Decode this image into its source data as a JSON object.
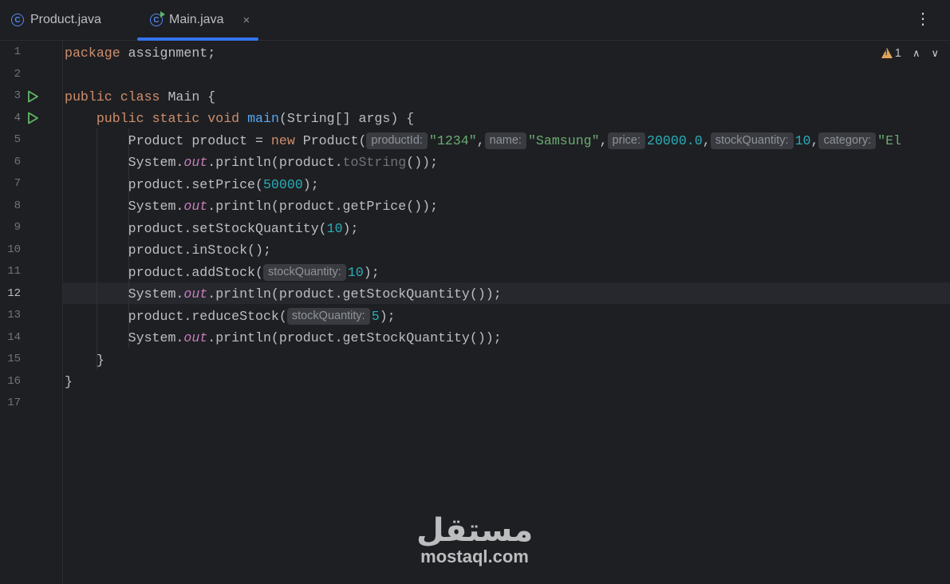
{
  "tabs": [
    {
      "label": "Product.java",
      "active": false,
      "icon": "class-icon"
    },
    {
      "label": "Main.java",
      "active": true,
      "icon": "runnable-class-icon",
      "close": "×"
    }
  ],
  "menu_glyph": "⋮",
  "inspection": {
    "warning_count": "1",
    "up": "∧",
    "down": "∨"
  },
  "line_numbers": [
    "1",
    "2",
    "3",
    "4",
    "5",
    "6",
    "7",
    "8",
    "9",
    "10",
    "11",
    "12",
    "13",
    "14",
    "15",
    "16",
    "17"
  ],
  "current_line": 12,
  "code": {
    "l1": {
      "kw": "package",
      "rest": " assignment;"
    },
    "l3": {
      "kw1": "public",
      "kw2": "class",
      "rest": " Main {"
    },
    "l4": {
      "kw1": "public",
      "kw2": "static",
      "kw3": "void",
      "fn": "main",
      "rest": "(String[] args) {"
    },
    "l5": {
      "a": "Product product = ",
      "kw": "new",
      "b": " Product(",
      "h1": "productId:",
      "s1": "\"1234\"",
      "c1": ",",
      "h2": "name:",
      "s2": "\"Samsung\"",
      "c2": ",",
      "h3": "price:",
      "n1": "20000.0",
      "c3": ",",
      "h4": "stockQuantity:",
      "n2": "10",
      "c4": ",",
      "h5": "category:",
      "s3": "\"El"
    },
    "l6": {
      "a": "System.",
      "stat": "out",
      "b": ".println(product.",
      "dim": "toString",
      "c": "());"
    },
    "l7": {
      "a": "product.setPrice(",
      "num": "50000",
      "b": ");"
    },
    "l8": {
      "a": "System.",
      "stat": "out",
      "b": ".println(product.getPrice());"
    },
    "l9": {
      "a": "product.setStockQuantity(",
      "num": "10",
      "b": ");"
    },
    "l10": {
      "a": "product.inStock();"
    },
    "l11": {
      "a": "product.addStock(",
      "hint": "stockQuantity:",
      "num": "10",
      "b": ");"
    },
    "l12": {
      "a": "System.",
      "stat": "out",
      "b": ".println(product.getStockQuantity());"
    },
    "l13": {
      "a": "product.reduceStock(",
      "hint": "stockQuantity:",
      "num": "5",
      "b": ");"
    },
    "l14": {
      "a": "System.",
      "stat": "out",
      "b": ".println(product.getStockQuantity());"
    },
    "l15": {
      "a": "}"
    },
    "l16": {
      "a": "}"
    }
  },
  "watermark": {
    "arabic": "مستقل",
    "latin": "mostaql.com"
  },
  "colors": {
    "accent": "#3574f0",
    "run": "#5fb865",
    "warning": "#e0a35a"
  }
}
